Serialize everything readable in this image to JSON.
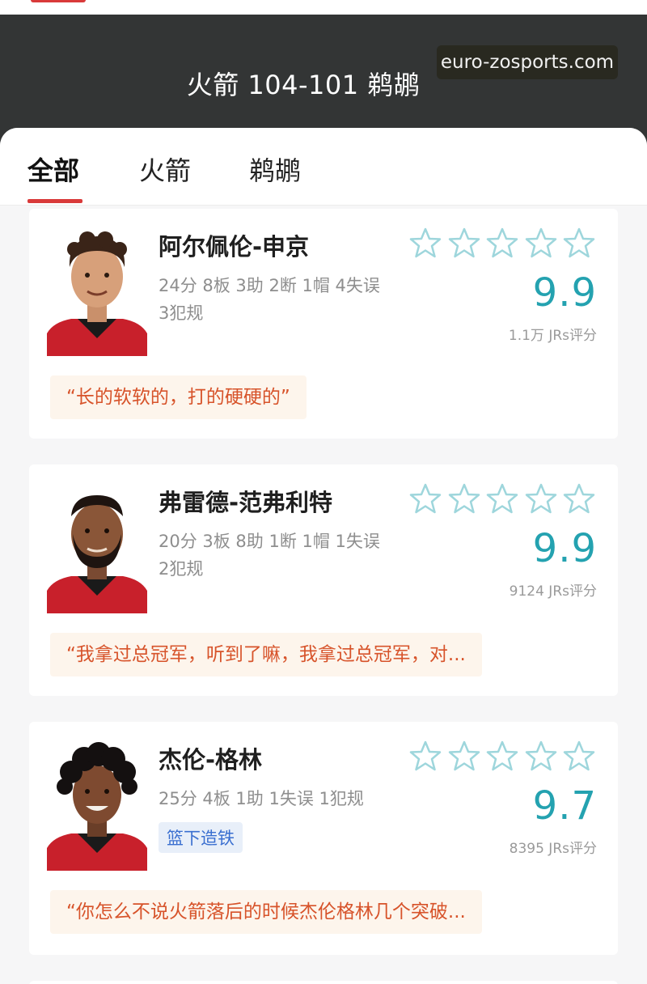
{
  "header": {
    "title": "火箭 104-101 鹈鹕",
    "watermark": "euro-zosports.com"
  },
  "tabs": [
    {
      "label": "全部",
      "active": true
    },
    {
      "label": "火箭",
      "active": false
    },
    {
      "label": "鹈鹕",
      "active": false
    }
  ],
  "colors": {
    "accent": "#d93a3a",
    "score": "#24a2b0",
    "quote_text": "#d7532a",
    "header_bg": "#333535",
    "star": "#9ed6dc"
  },
  "players": [
    {
      "name": "阿尔佩伦-申京",
      "stats_line1": "24分 8板 3助 2断 1帽 4失误",
      "stats_line2": "3犯规",
      "tag": "",
      "stars_filled": 0,
      "score": "9.9",
      "votes": "1.1万 JRs评分",
      "quote": "“长的软软的，打的硬硬的”",
      "avatar_icon": "player-avatar-curly-hair"
    },
    {
      "name": "弗雷德-范弗利特",
      "stats_line1": "20分 3板 8助 1断 1帽 1失误",
      "stats_line2": "2犯规",
      "tag": "",
      "stars_filled": 0,
      "score": "9.9",
      "votes": "9124 JRs评分",
      "quote": "“我拿过总冠军，听到了嘛，我拿过总冠军，对...",
      "avatar_icon": "player-avatar-bearded"
    },
    {
      "name": "杰伦-格林",
      "stats_line1": "25分 4板 1助 1失误 1犯规",
      "stats_line2": "",
      "tag": "篮下造铁",
      "stars_filled": 0,
      "score": "9.7",
      "votes": "8395 JRs评分",
      "quote": "“你怎么不说火箭落后的时候杰伦格林几个突破...",
      "avatar_icon": "player-avatar-afro"
    }
  ]
}
